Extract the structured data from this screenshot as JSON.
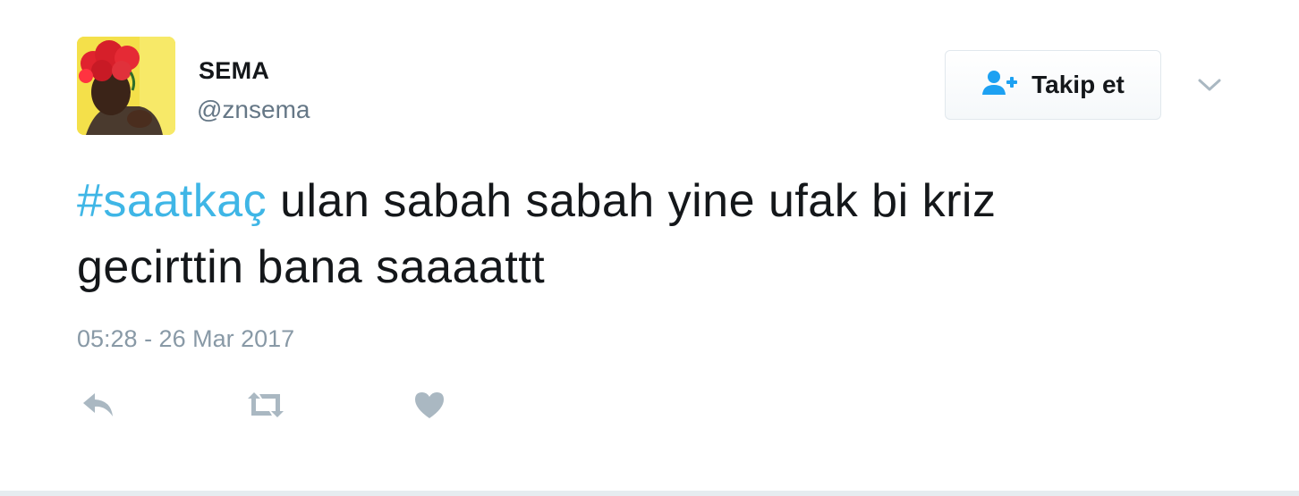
{
  "user": {
    "display_name": "SEMA",
    "handle": "@znsema"
  },
  "follow_button": {
    "label": "Takip et",
    "icon": "add-user-icon"
  },
  "tweet": {
    "hashtag": "#saatkaç",
    "text_line1": " ulan sabah sabah yine ufak bi kriz",
    "text_line2": "gecirttin bana saaaattt",
    "timestamp": "05:28 - 26 Mar 2017"
  },
  "actions": [
    {
      "icon": "reply-icon"
    },
    {
      "icon": "retweet-icon"
    },
    {
      "icon": "heart-icon"
    }
  ],
  "colors": {
    "hashtag": "#3fb6e6",
    "follow_icon": "#1da1f2",
    "muted": "#8899a6",
    "text": "#14171a"
  }
}
